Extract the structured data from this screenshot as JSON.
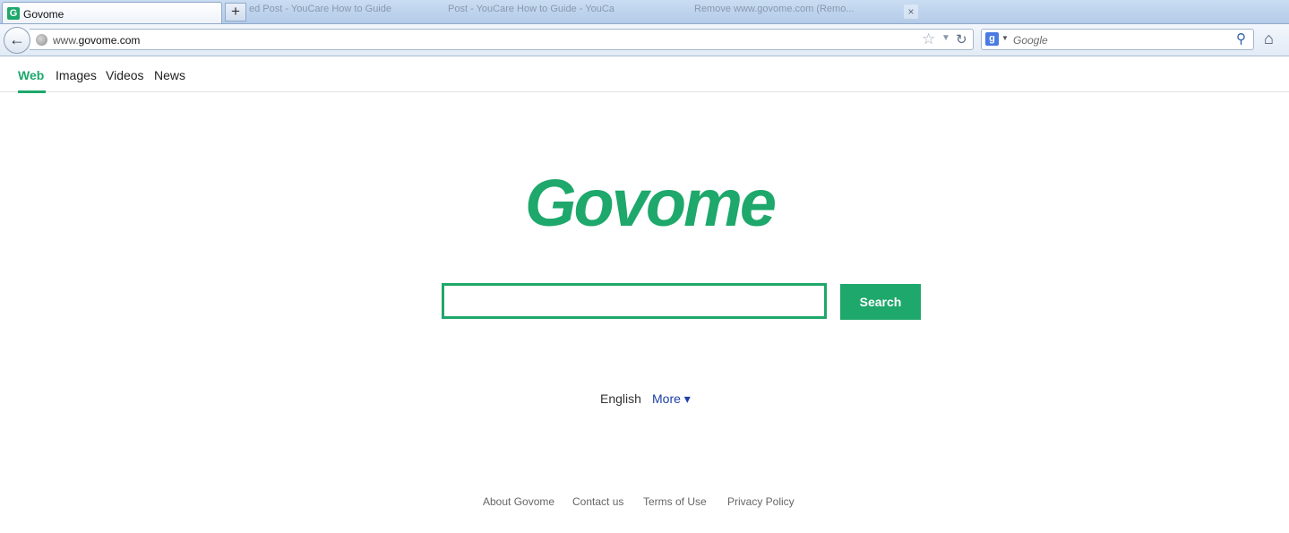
{
  "browser": {
    "tab": {
      "title": "Govome",
      "favicon": "G"
    },
    "new_tab": "+",
    "bg_tabs": [
      "ed Post - YouCare How to Guide",
      "Post - YouCare How to Guide - YouCa",
      "Remove www.govome.com (Remo..."
    ],
    "bg_tab_close": "×",
    "back": "←",
    "url_prefix": "www.",
    "url_domain": "govome.com",
    "search_engine_placeholder": "Google",
    "icons": {
      "star": "☆",
      "dropdown": "▼",
      "reload": "↻",
      "google_g": "g",
      "engine_dropdown": "▼",
      "magnifier": "⚲",
      "home": "⌂"
    }
  },
  "page": {
    "nav": [
      {
        "label": "Web",
        "active": true
      },
      {
        "label": "Images",
        "active": false
      },
      {
        "label": "Videos",
        "active": false
      },
      {
        "label": "News",
        "active": false
      }
    ],
    "logo": "Govome",
    "search": {
      "value": "",
      "button_label": "Search"
    },
    "language": {
      "current": "English",
      "more_label": "More ▾"
    },
    "footer_links": [
      "About Govome",
      "Contact us",
      "Terms of Use",
      "Privacy Policy"
    ],
    "accent_color": "#1ea86b"
  }
}
